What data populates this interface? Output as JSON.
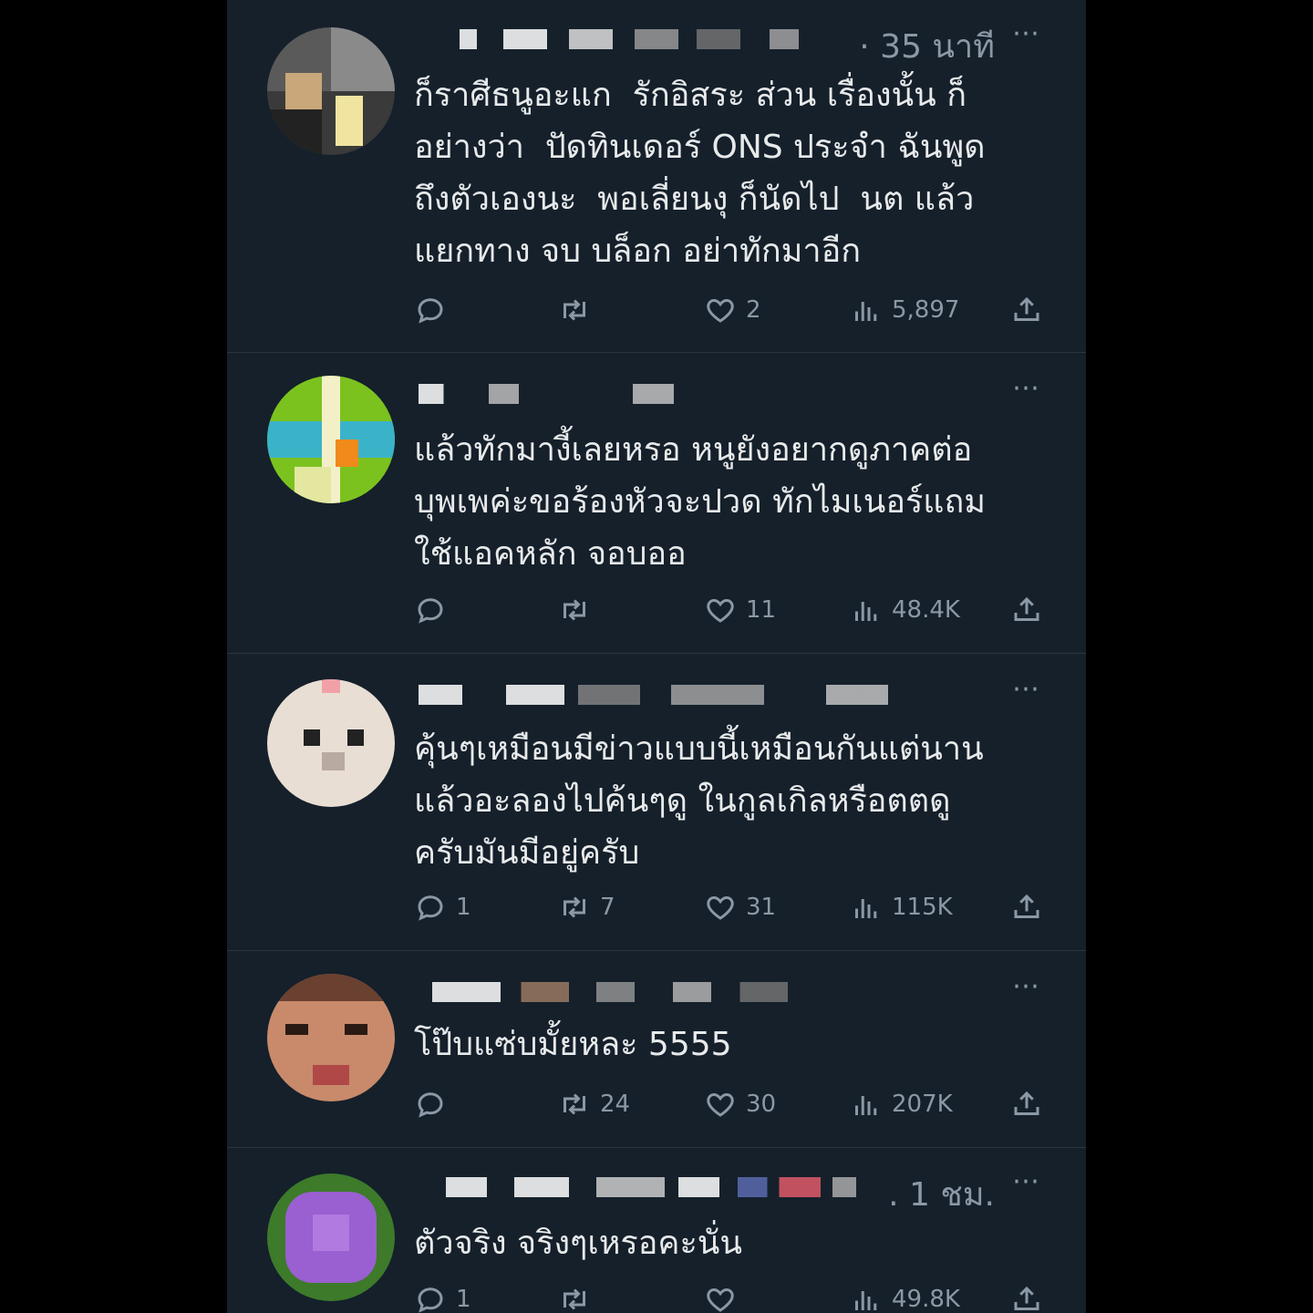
{
  "tweets": [
    {
      "time": "· 35 นาที",
      "text": "ก็ราศีธนูอะแก  รักอิสระ ส่วน เรื่องนั้น ก็\nอย่างว่า  ปัดทินเดอร์ ONS ประจำ ฉันพูด\nถึงตัวเองนะ  พอเลี่ยนงุ ก็นัดไป  นต แล้ว\nแยกทาง จบ บล็อก อย่าทักมาอีก",
      "replies": "",
      "retweets": "",
      "likes": "2",
      "views": "5,897"
    },
    {
      "time": "",
      "text": "แล้วทักมางี้เลยหรอ หนูยังอยากดูภาคต่อ\nบุพเพค่ะขอร้องหัวจะปวด ทักไมเนอร์แถม\nใช้แอคหลัก จอบออ",
      "replies": "",
      "retweets": "",
      "likes": "11",
      "views": "48.4K"
    },
    {
      "time": "",
      "text": "คุ้นๆเหมือนมีข่าวแบบนี้เหมือนกันแต่นาน\nแล้วอะลองไปค้นๆดู ในกูลเกิลหรือตตดู\nครับมันมีอยู่ครับ",
      "replies": "1",
      "retweets": "7",
      "likes": "31",
      "views": "115K"
    },
    {
      "time": "",
      "text": "โป๊บแซ่บมั้ยหละ 5555",
      "replies": "",
      "retweets": "24",
      "likes": "30",
      "views": "207K"
    },
    {
      "time": ". 1 ชม.",
      "text": "ตัวจริง จริงๆเหรอคะนั่น",
      "replies": "1",
      "retweets": "",
      "likes": "",
      "views": "49.8K"
    }
  ],
  "icons": {
    "reply": "reply-icon",
    "retweet": "retweet-icon",
    "like": "heart-icon",
    "views": "views-icon",
    "share": "share-icon",
    "more": "more-icon"
  },
  "colors": {
    "background": "#15202b",
    "text": "#e7e9ea",
    "secondary": "#8b98a5"
  }
}
